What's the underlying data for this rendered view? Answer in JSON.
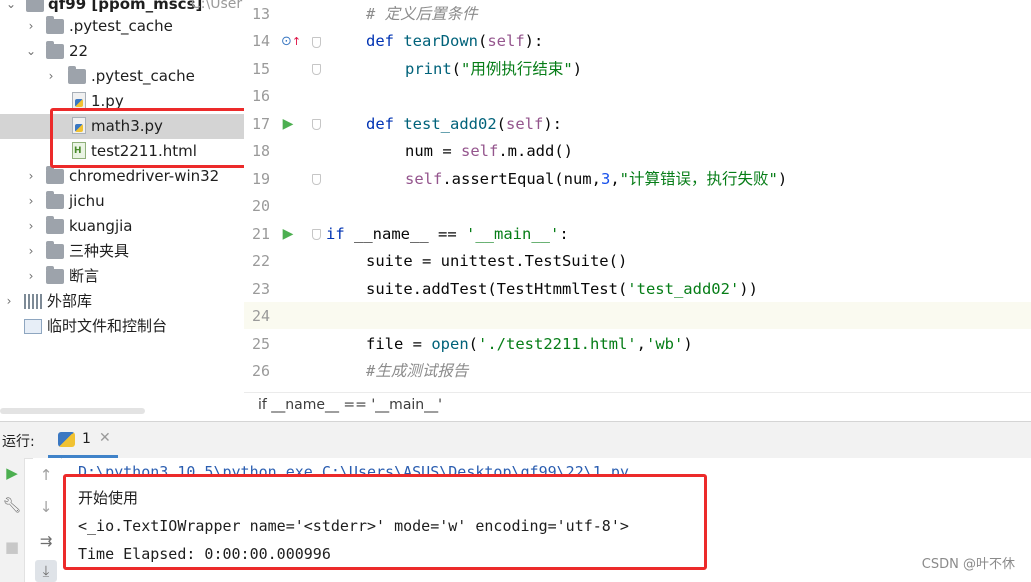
{
  "tree": {
    "rows": [
      {
        "label": "qf99 [ppom_mscs]",
        "path_hint": "C:\\User",
        "type": "root",
        "expanded": true
      },
      {
        "label": ".pytest_cache",
        "type": "folder",
        "expanded": false
      },
      {
        "label": "22",
        "type": "folder",
        "expanded": true
      },
      {
        "label": ".pytest_cache",
        "type": "folder",
        "expanded": false
      },
      {
        "label": "1.py",
        "type": "py-file"
      },
      {
        "label": "math3.py",
        "type": "py-file",
        "selected": true
      },
      {
        "label": "test2211.html",
        "type": "html-file"
      },
      {
        "label": "chromedriver-win32",
        "type": "folder",
        "expanded": false
      },
      {
        "label": "jichu",
        "type": "folder",
        "expanded": false
      },
      {
        "label": "kuangjia",
        "type": "folder",
        "expanded": false
      },
      {
        "label": "三种夹具",
        "type": "folder",
        "expanded": false
      },
      {
        "label": "断言",
        "type": "folder",
        "expanded": false
      },
      {
        "label": "外部库",
        "type": "library",
        "expanded": false
      },
      {
        "label": "临时文件和控制台",
        "type": "scratch"
      }
    ]
  },
  "editor": {
    "line_numbers": [
      "13",
      "14",
      "15",
      "16",
      "17",
      "18",
      "19",
      "20",
      "21",
      "22",
      "23",
      "24",
      "25",
      "26"
    ],
    "lines": {
      "l13": "# 定义后置条件",
      "l14_kw": "def",
      "l14_fn": "tearDown",
      "l14_self": "self",
      "l15_fn": "print",
      "l15_str": "\"用例执行结束\"",
      "l17_kw": "def",
      "l17_fn": "test_add02",
      "l17_self": "self",
      "l18_a": "num = ",
      "l18_self": "self",
      "l18_b": ".m.add()",
      "l19_self": "self",
      "l19_a": ".assertEqual(num,",
      "l19_num": "3",
      "l19_str": "\"计算错误，执行失败\"",
      "l21_kw": "if",
      "l21_name": "__name__",
      "l21_op": " == ",
      "l21_str": "'__main__'",
      "l22": "suite = unittest.TestSuite()",
      "l23_a": "suite.addTest(TestHtmmlTest(",
      "l23_str": "'test_add02'",
      "l23_b": "))",
      "l25_a": "file = ",
      "l25_fn": "open",
      "l25_str1": "'./test2211.html'",
      "l25_str2": "'wb'",
      "l26": "#生成测试报告"
    },
    "breadcrumb": "if __name__ == '__main__'"
  },
  "run": {
    "label": "运行:",
    "tab_label": "1",
    "console": {
      "cmd": "D:\\python3_10_5\\python.exe C:\\Users\\ASUS\\Desktop\\qf99\\22\\1.py",
      "line1": "开始使用",
      "line2": "<_io.TextIOWrapper name='<stderr>' mode='w' encoding='utf-8'>",
      "line3": "Time Elapsed: 0:00:00.000996"
    }
  },
  "watermark": "CSDN @叶不休",
  "colors": {
    "highlight_box": "#ec2a2a",
    "run_icon": "#4caf50",
    "tab_accent": "#4083c9"
  }
}
